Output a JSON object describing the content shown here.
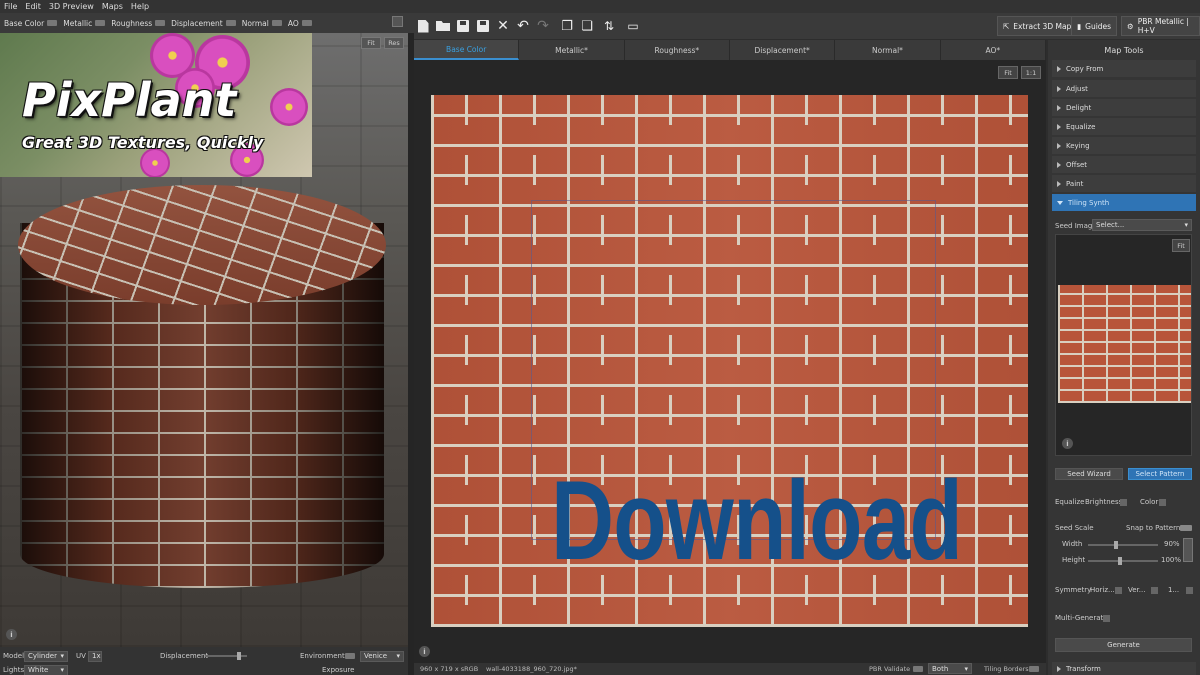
{
  "menu": [
    "File",
    "Edit",
    "3D Preview",
    "Maps",
    "Help"
  ],
  "channels": [
    "Base Color",
    "Metallic",
    "Roughness",
    "Displacement",
    "Normal",
    "AO"
  ],
  "toolbar": {
    "extract_label": "Extract 3D Maps",
    "guides_label": "Guides",
    "pbr_label": "PBR Metallic | H+V"
  },
  "viewport": {
    "fit_label": "Fit",
    "reset_label": "Res",
    "logo_title": "PixPlant",
    "logo_subtitle": "Great 3D Textures, Quickly",
    "info_icon": "i"
  },
  "left_bottom": {
    "model_label": "Model",
    "model_value": "Cylinder",
    "uv_label": "UV",
    "uv_value": "1x",
    "displacement_label": "Displacement",
    "environment_label": "Environment",
    "environment_value": "Venice",
    "lights_label": "Lights",
    "lights_value": "White",
    "exposure_label": "Exposure"
  },
  "tabs": [
    "Base Color",
    "Metallic*",
    "Roughness*",
    "Displacement*",
    "Normal*",
    "AO*"
  ],
  "canvas": {
    "fit_label": "Fit",
    "one_label": "1:1",
    "overlay_text": "Download",
    "info_icon": "i"
  },
  "status": {
    "dimensions": "960 x 719 x sRGB",
    "filename": "wall-4033188_960_720.jpg*",
    "pbr_validate": "PBR Validate",
    "both": "Both",
    "tiling_borders": "Tiling Borders"
  },
  "map_tools": {
    "title": "Map Tools",
    "items": [
      "Copy From",
      "Adjust",
      "Delight",
      "Equalize",
      "Keying",
      "Offset",
      "Paint",
      "Tiling Synth"
    ],
    "seed_image_label": "Seed Image",
    "seed_image_value": "Select...",
    "fit_label": "Fit",
    "info_icon": "i",
    "seed_wizard": "Seed Wizard",
    "select_pattern": "Select Pattern",
    "equalize_label": "Equalize",
    "brightness_label": "Brightness",
    "color_label": "Color",
    "seed_scale_label": "Seed Scale",
    "snap_label": "Snap to Pattern",
    "width_label": "Width",
    "width_value": "90%",
    "height_label": "Height",
    "height_value": "100%",
    "symmetry_label": "Symmetry",
    "horiz_label": "Horiz...",
    "vert_label": "Ver...",
    "one_label": "1...",
    "multi_label": "Multi-Generate",
    "generate_label": "Generate",
    "transform_label": "Transform"
  },
  "colors": {
    "accent": "#2f74b5",
    "download_text": "#15508a",
    "brick": "#b8553a"
  }
}
